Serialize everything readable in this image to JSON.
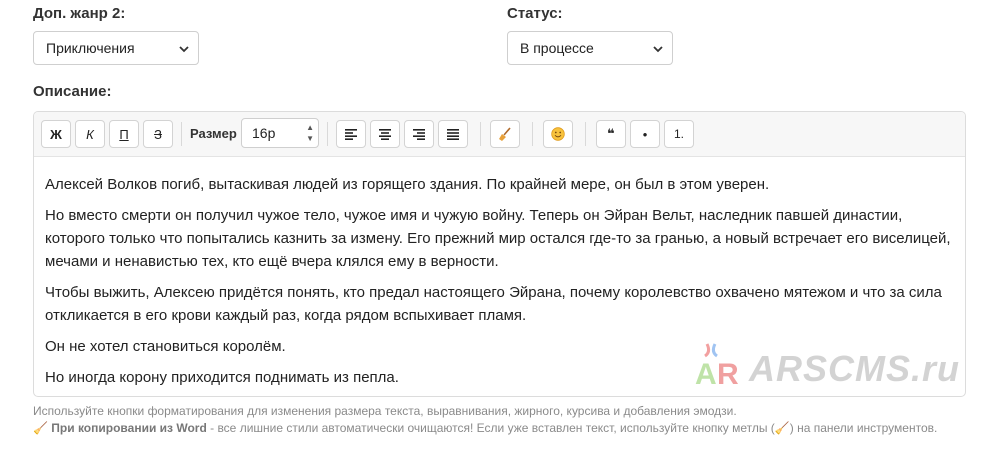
{
  "genre2": {
    "label": "Доп. жанр 2:",
    "value": "Приключения"
  },
  "status": {
    "label": "Статус:",
    "value": "В процессе"
  },
  "description": {
    "label": "Описание:"
  },
  "toolbar": {
    "bold": "Ж",
    "italic": "К",
    "underline": "П",
    "strike": "З",
    "size_label": "Размер",
    "size_value": "16р",
    "quote": "❝",
    "bullet": "•",
    "numbered": "1."
  },
  "content": {
    "paragraphs": [
      "Алексей Волков погиб, вытаскивая людей из горящего здания. По крайней мере, он был в этом уверен.",
      "Но вместо смерти он получил чужое тело, чужое имя и чужую войну. Теперь он Эйран Вельт, наследник павшей династии, которого только что попытались казнить за измену. Его прежний мир остался где-то за гранью, а новый встречает его виселицей, мечами и ненавистью тех, кто ещё вчера клялся ему в верности.",
      "Чтобы выжить, Алексею придётся понять, кто предал настоящего Эйрана, почему королевство охвачено мятежом и что за сила откликается в его крови каждый раз, когда рядом вспыхивает пламя.",
      "Он не хотел становиться королём.",
      "Но иногда корону приходится поднимать из пепла."
    ]
  },
  "watermark": {
    "logo": "AR",
    "text": "ARSCMS.ru"
  },
  "hint": {
    "line1": "Используйте кнопки форматирования для изменения размера текста, выравнивания, жирного, курсива и добавления эмодзи.",
    "word_icon": "🧹",
    "word_bold": "При копировании из Word",
    "word_rest": " - все лишние стили автоматически очищаются! Если уже вставлен текст, используйте кнопку метлы (🧹) на панели инструментов."
  },
  "colors": {
    "border": "#dcdcdc",
    "toolbar_bg": "#f7f7f7",
    "hint": "#8a8a8a"
  }
}
